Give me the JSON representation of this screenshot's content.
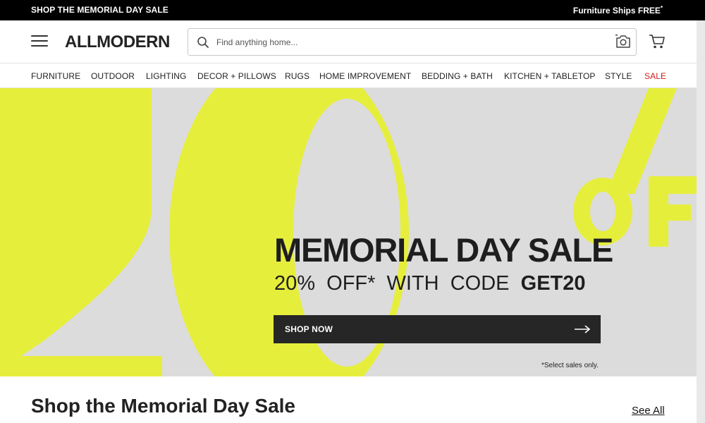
{
  "promo": {
    "left_text": "SHOP THE MEMORIAL DAY SALE",
    "right_text": "Furniture Ships FREE",
    "right_sup": "*"
  },
  "header": {
    "logo": "ALLMODERN",
    "search_placeholder": "Find anything home...",
    "icons": [
      "menu-icon",
      "search-icon",
      "camera-icon",
      "cart-icon"
    ]
  },
  "nav": {
    "items": [
      {
        "label": "FURNITURE"
      },
      {
        "label": "OUTDOOR"
      },
      {
        "label": "LIGHTING"
      },
      {
        "label": "DECOR + PILLOWS"
      },
      {
        "label": "RUGS"
      },
      {
        "label": "HOME IMPROVEMENT"
      },
      {
        "label": "BEDDING + BATH"
      },
      {
        "label": "KITCHEN + TABLETOP"
      },
      {
        "label": "STYLE"
      },
      {
        "label": "SALE"
      }
    ]
  },
  "hero": {
    "title": "MEMORIAL DAY SALE",
    "sub_prefix": "20%  OFF*  WITH  CODE",
    "code": "GET20",
    "button_label": "SHOP NOW",
    "note": "*Select sales only.",
    "colors": {
      "accent": "#e6ee3c",
      "background": "#dcdcdc",
      "button": "#262626"
    }
  },
  "section": {
    "title": "Shop the Memorial Day Sale",
    "see_all": "See All"
  },
  "colors": {
    "sale": "#d11d1d",
    "promo_bar": "#000000"
  }
}
